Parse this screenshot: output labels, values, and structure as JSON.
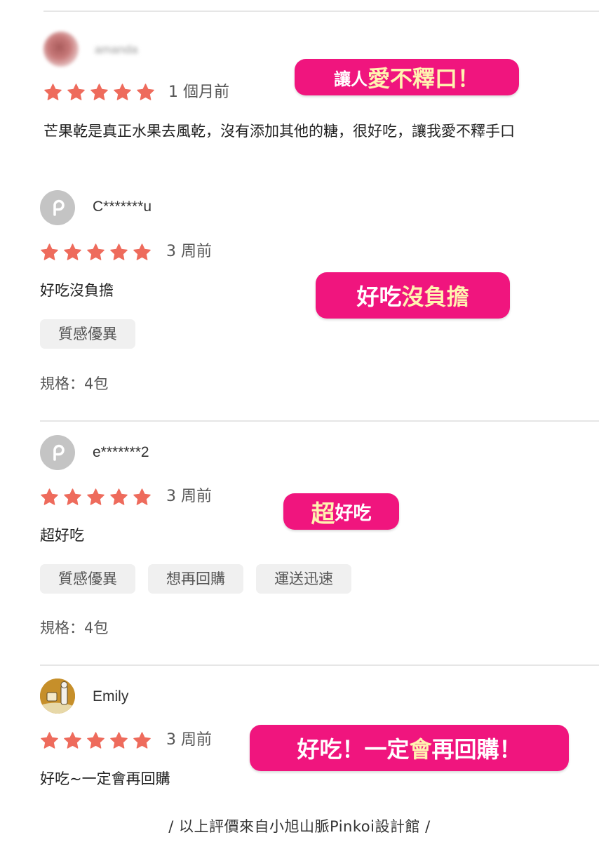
{
  "colors": {
    "star": "#ee6b5c",
    "badge_bg": "#f0157e",
    "badge_highlight": "#fff3b0",
    "tag_bg": "#f0f0f0",
    "divider": "#e6e6e6"
  },
  "reviews": [
    {
      "username": "amanda",
      "avatar": "blurred-photo",
      "rating": 5,
      "time": "1 個月前",
      "comment": "芒果乾是真正水果去風乾，沒有添加其他的糖，很好吃，讓我愛不釋手口",
      "tags": [],
      "spec": null,
      "badge": {
        "plain_before": "讓人",
        "highlight": "愛不釋口！",
        "plain_after": ""
      }
    },
    {
      "username": "C*******u",
      "avatar": "pinkoi-p-icon",
      "rating": 5,
      "time": "3 周前",
      "comment": "好吃沒負擔",
      "tags": [
        "質感優異"
      ],
      "spec": {
        "label": "規格：",
        "value": "4包"
      },
      "badge": {
        "plain_before": "好吃",
        "highlight": "沒負擔",
        "plain_after": ""
      }
    },
    {
      "username": "e*******2",
      "avatar": "pinkoi-p-icon",
      "rating": 5,
      "time": "3 周前",
      "comment": "超好吃",
      "tags": [
        "質感優異",
        "想再回購",
        "運送迅速"
      ],
      "spec": {
        "label": "規格：",
        "value": "4包"
      },
      "badge": {
        "plain_before": "",
        "highlight": "超",
        "plain_after": "好吃"
      }
    },
    {
      "username": "Emily",
      "avatar": "cartoon-avatar",
      "rating": 5,
      "time": "3 周前",
      "comment": "好吃~一定會再回購",
      "tags": [],
      "spec": null,
      "badge": {
        "plain_before": "好吃！一定",
        "highlight": "會",
        "plain_after": "再回購！"
      }
    }
  ],
  "footer": "/ 以上評價來自小旭山脈Pinkoi設計館 /"
}
